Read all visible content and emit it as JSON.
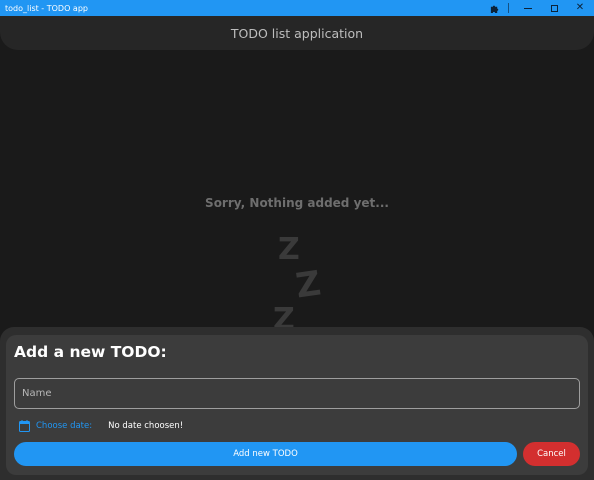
{
  "window": {
    "title": "todo_list - TODO app",
    "icons": {
      "extension": "puzzle-icon",
      "minimize": "minimize-icon",
      "maximize": "maximize-icon",
      "close": "close-icon"
    },
    "accent": "#2196f3"
  },
  "appbar": {
    "title": "TODO list application"
  },
  "empty_state": {
    "message": "Sorry, Nothing added yet...",
    "sleep_glyphs": [
      "Z",
      "Z",
      "Z"
    ]
  },
  "sheet": {
    "title": "Add a new TODO:",
    "name_placeholder": "Name",
    "name_value": "",
    "date_icon": "calendar-icon",
    "choose_date_label": "Choose date:",
    "date_status": "No date choosen!",
    "add_button_label": "Add new TODO",
    "cancel_button_label": "Cancel",
    "colors": {
      "add": "#2196f3",
      "cancel": "#d32f2f"
    }
  }
}
